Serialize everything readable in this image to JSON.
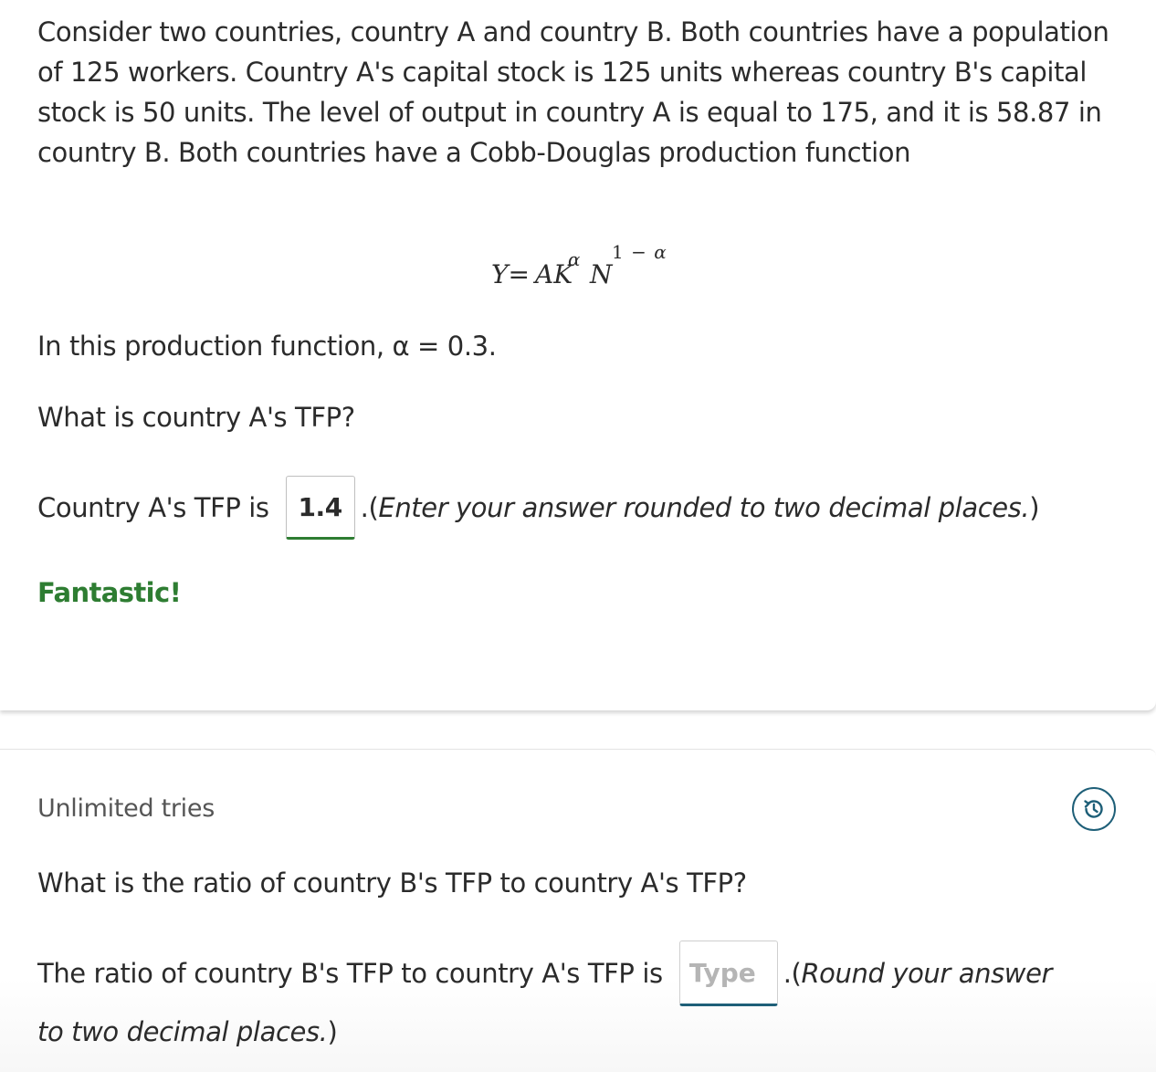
{
  "question_a": {
    "intro": "Consider two countries, country A and country B. Both countries have a population of 125 workers. Country A's capital stock is 125 units whereas country B's capital stock is 50 units. The level of output in country A is equal to 175, and it is  58.87 in country B. Both countries have a Cobb-Douglas production function",
    "equation": {
      "lhs": "Y=",
      "a": "AK",
      "alpha_sup": "α",
      "n": "N",
      "exp_prefix": "1 − ",
      "exp_alpha": "α"
    },
    "alpha_line": "In this production function, α = 0.3.",
    "question": "What is country A's TFP?",
    "answer_prefix": "Country A's TFP is",
    "answer_value": "1.4",
    "answer_suffix_dot": ". ",
    "answer_instruction_open": "(",
    "answer_instruction": "Enter your answer rounded to two decimal places.",
    "answer_instruction_close": ")",
    "feedback": "Fantastic!"
  },
  "question_b": {
    "tries": "Unlimited tries",
    "question": "What is the ratio of country B's TFP to country A's TFP?",
    "answer_prefix": "The ratio of country B's TFP to country A's TFP is",
    "answer_placeholder": "Type",
    "answer_value": "",
    "answer_suffix_dot": ". ",
    "instruction_open": "(",
    "instruction_part1": "Round your answer",
    "instruction_part2": "to two decimal places.",
    "instruction_close": ")"
  },
  "icons": {
    "history": "history-icon"
  },
  "colors": {
    "correct_green": "#2e7d32",
    "accent_teal": "#1e5f78",
    "text": "#2b2b2b",
    "muted": "#555555"
  }
}
